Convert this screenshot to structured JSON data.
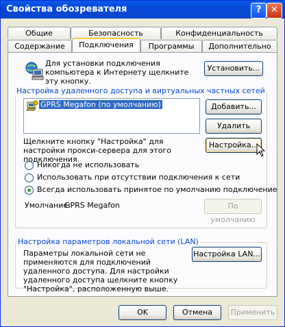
{
  "window": {
    "title": "Свойства обозревателя"
  },
  "title_buttons": {
    "help": "?",
    "close": "✕"
  },
  "tabs_back": [
    "Общие",
    "Безопасность",
    "Конфиденциальность"
  ],
  "tabs_front": [
    "Содержание",
    "Подключения",
    "Программы",
    "Дополнительно"
  ],
  "setup": {
    "text": "Для установки подключения компьютера к Интернету щелкните эту кнопку.",
    "button": "Установить..."
  },
  "dialup": {
    "group_title": "Настройка удаленного доступа и виртуальных частных сетей",
    "list_item": "GPRS Megafon (по умолчанию)",
    "add_button": "Добавить...",
    "remove_button": "Удалить",
    "settings_text": "Щелкните кнопку \"Настройка\" для настройки прокси-сервера для этого подключения.",
    "settings_button": "Настройка...",
    "radio_options": [
      "Никогда не использовать",
      "Использовать при отсутствии подключения к сети",
      "Всегда использовать принятое по умолчанию подключение"
    ],
    "selected_option_index": 2,
    "default_label": "Умолчание:",
    "default_value": "GPRS Megafon",
    "default_button": "По умолчанию"
  },
  "lan": {
    "group_title": "Настройка параметров локальной сети (LAN)",
    "text": "Параметры локальной сети не применяются для подключений удаленного доступа. Для настройки удаленного доступа щелкните кнопку \"Настройка\", расположенную выше.",
    "button": "Настройка LAN..."
  },
  "footer": {
    "ok": "OK",
    "cancel": "Отмена",
    "apply": "Применить"
  },
  "colors": {
    "title_bar": "#0A5AE8",
    "group_title": "#0046D5",
    "selection": "#316AC5",
    "radio_dot": "#2D9E2D"
  }
}
